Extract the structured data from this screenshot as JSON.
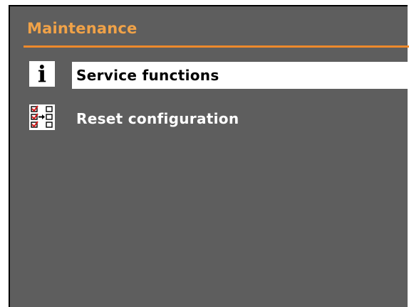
{
  "screen": {
    "title": "Maintenance",
    "menu": [
      {
        "label": "Service functions",
        "icon": "info-icon",
        "selected": true
      },
      {
        "label": "Reset configuration",
        "icon": "reset-configuration-icon",
        "selected": false
      }
    ]
  },
  "colors": {
    "background": "#5e5e5e",
    "title_text": "#f0a248",
    "title_rule": "#ee8a2c",
    "selection_background": "#ffffff",
    "selection_text": "#000000",
    "item_text": "#ffffff"
  },
  "icons": {
    "info_glyph": "i"
  }
}
